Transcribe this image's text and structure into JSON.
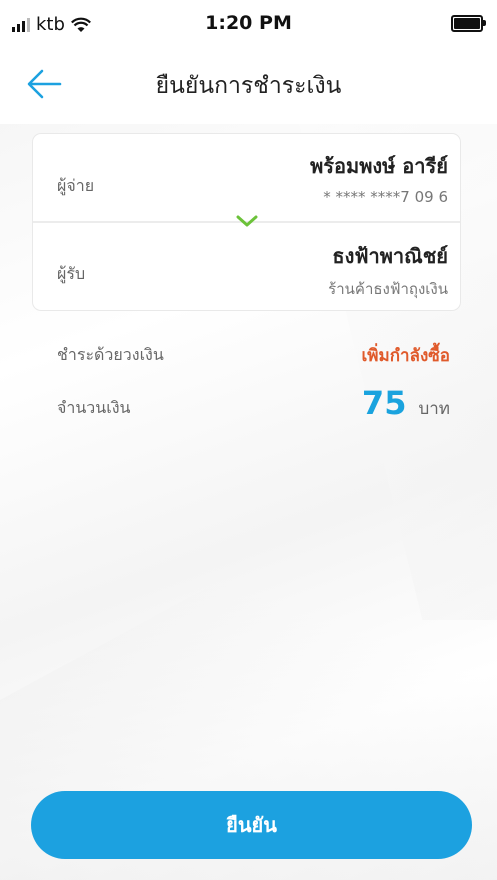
{
  "status_bar": {
    "carrier": "ktb",
    "time": "1:20 PM"
  },
  "nav": {
    "title": "ยืนยันการชำระเงิน",
    "back_icon": "arrow-left-icon"
  },
  "payer": {
    "label": "ผู้จ่าย",
    "name": "พร้อมพงษ์ อารีย์",
    "account": "* **** ****7 09 6"
  },
  "payee": {
    "label": "ผู้รับ",
    "name": "ธงฟ้าพาณิชย์",
    "store": "ร้านค้าธงฟ้าถุงเงิน"
  },
  "pay_with": {
    "label": "ชำระด้วยวงเงิน",
    "action": "เพิ่มกำลังซื้อ"
  },
  "amount": {
    "label": "จำนวนเงิน",
    "value": "75",
    "unit": "บาท"
  },
  "confirm_label": "ยืนยัน",
  "colors": {
    "accent": "#1ca1e0",
    "action": "#e05a2b",
    "chevron": "#6cc23a"
  }
}
